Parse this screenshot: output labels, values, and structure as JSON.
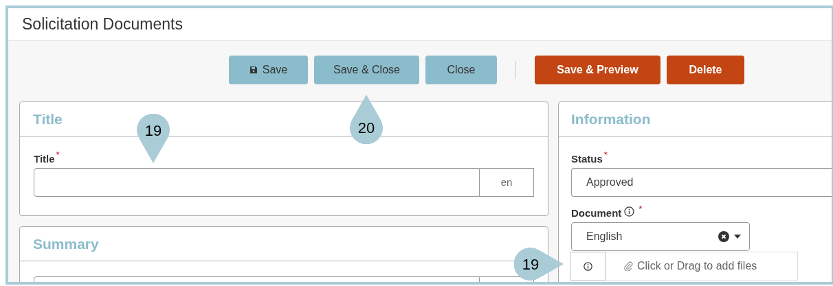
{
  "page": {
    "title": "Solicitation Documents"
  },
  "toolbar": [
    {
      "label": "Save",
      "kind": "primary"
    },
    {
      "label": "Save & Close",
      "kind": "primary"
    },
    {
      "label": "Close",
      "kind": "primary"
    },
    {
      "kind": "separator"
    },
    {
      "label": "Save & Preview",
      "kind": "danger"
    },
    {
      "label": "Delete",
      "kind": "danger"
    }
  ],
  "left_panels": [
    {
      "heading": "Title",
      "field": {
        "label": "Title",
        "required_mark": "*",
        "language": "en"
      }
    },
    {
      "heading": "Summary"
    }
  ],
  "information": {
    "heading": "Information",
    "status": {
      "label": "Status",
      "required_mark": "*",
      "value": "Approved"
    },
    "document": {
      "label": "Document",
      "required_mark": "*",
      "value": "English"
    },
    "upload": {
      "text": "Click or Drag to add files"
    }
  },
  "markers": [
    {
      "number": "19",
      "kind": "down"
    },
    {
      "number": "20",
      "kind": "up"
    },
    {
      "number": "19",
      "kind": "right"
    }
  ]
}
